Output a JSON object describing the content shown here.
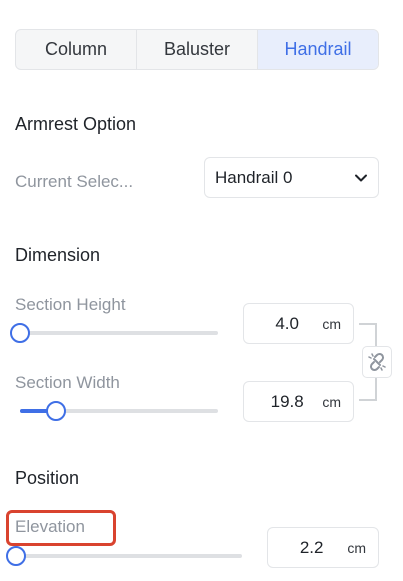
{
  "tabs": [
    {
      "label": "Column",
      "active": false
    },
    {
      "label": "Baluster",
      "active": false
    },
    {
      "label": "Handrail",
      "active": true
    }
  ],
  "armrest": {
    "heading": "Armrest Option",
    "current_label": "Current Selec...",
    "current_value": "Handrail 0",
    "dropdown_icon": "chevron-down-icon"
  },
  "dimension": {
    "heading": "Dimension",
    "section_height": {
      "label": "Section Height",
      "value": "4.0",
      "unit": "cm",
      "slider_fraction": 0.0
    },
    "section_width": {
      "label": "Section Width",
      "value": "19.8",
      "unit": "cm",
      "slider_fraction": 0.18
    },
    "link_icon": "unlink-icon"
  },
  "position": {
    "heading": "Position",
    "elevation": {
      "label": "Elevation",
      "value": "2.2",
      "unit": "cm",
      "slider_fraction": 0.0
    }
  },
  "colors": {
    "accent": "#3f6fe6",
    "highlight": "#d9432f"
  }
}
